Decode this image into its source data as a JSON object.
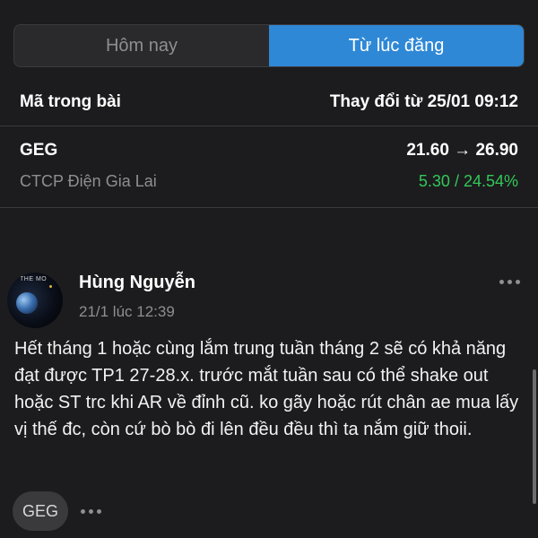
{
  "tabs": [
    {
      "label": "Hôm nay",
      "active": false
    },
    {
      "label": "Từ lúc đăng",
      "active": true
    }
  ],
  "header": {
    "left_label": "Mã trong bài",
    "right_label": "Thay đổi từ 25/01 09:12"
  },
  "stock": {
    "code": "GEG",
    "name": "CTCP Điện Gia Lai",
    "price_change": "21.60 → 26.90",
    "change_value": "5.30 / 24.54%"
  },
  "post": {
    "author": "Hùng Nguyễn",
    "time": "21/1 lúc 12:39",
    "avatar_text": "THE MO",
    "body": "Hết tháng 1 hoặc cùng lắm trung tuần tháng 2 sẽ có khả năng đạt được TP1 27-28.x. trước mắt tuần sau có thể shake out hoặc ST trc khi AR về đỉnh cũ. ko gãy hoặc rút chân ae mua lấy vị thế đc, còn cứ bò bò đi lên đều đều thì ta nắm giữ thoii.",
    "tag": "GEG"
  },
  "colors": {
    "background": "#1c1c1e",
    "accent": "#2f88d6",
    "positive": "#34c759",
    "muted": "#8e8e93"
  },
  "icons": {
    "post_more": "more-horizontal-icon",
    "tag_more": "more-horizontal-icon"
  }
}
